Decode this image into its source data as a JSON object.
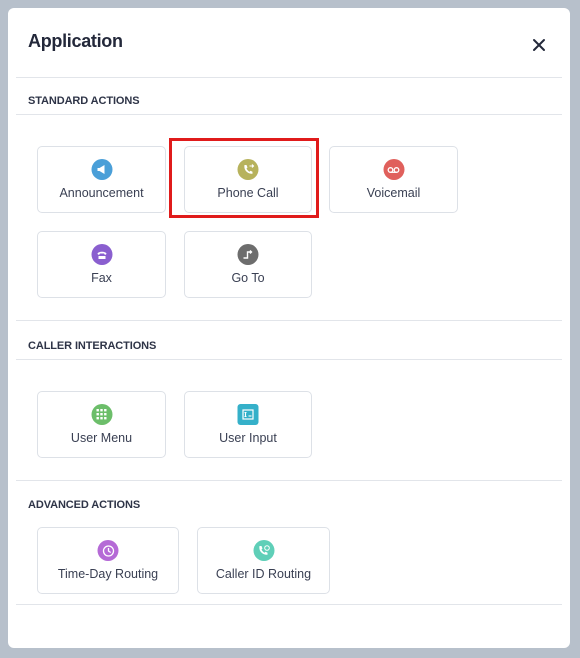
{
  "dialog": {
    "title": "Application",
    "close_icon": "close-icon"
  },
  "sections": {
    "standard": {
      "label": "STANDARD ACTIONS",
      "items": [
        {
          "label": "Announcement",
          "icon": "megaphone-icon",
          "color": "#4a9fd8"
        },
        {
          "label": "Phone Call",
          "icon": "phone-forward-icon",
          "color": "#b7b25c"
        },
        {
          "label": "Voicemail",
          "icon": "voicemail-icon",
          "color": "#e0605c"
        },
        {
          "label": "Fax",
          "icon": "fax-icon",
          "color": "#8a5fcf"
        },
        {
          "label": "Go To",
          "icon": "goto-step-icon",
          "color": "#6d6d6d"
        }
      ]
    },
    "caller": {
      "label": "CALLER INTERACTIONS",
      "items": [
        {
          "label": "User Menu",
          "icon": "keypad-icon",
          "color": "#6cbe6a"
        },
        {
          "label": "User Input",
          "icon": "input-icon",
          "color": "#35b0c9"
        }
      ]
    },
    "advanced": {
      "label": "ADVANCED ACTIONS",
      "items": [
        {
          "label": "Time-Day Routing",
          "icon": "clock-icon",
          "color": "#b56ad6"
        },
        {
          "label": "Caller ID Routing",
          "icon": "caller-id-icon",
          "color": "#5fcfb8"
        }
      ]
    }
  },
  "highlight_color": "#e01b1b"
}
